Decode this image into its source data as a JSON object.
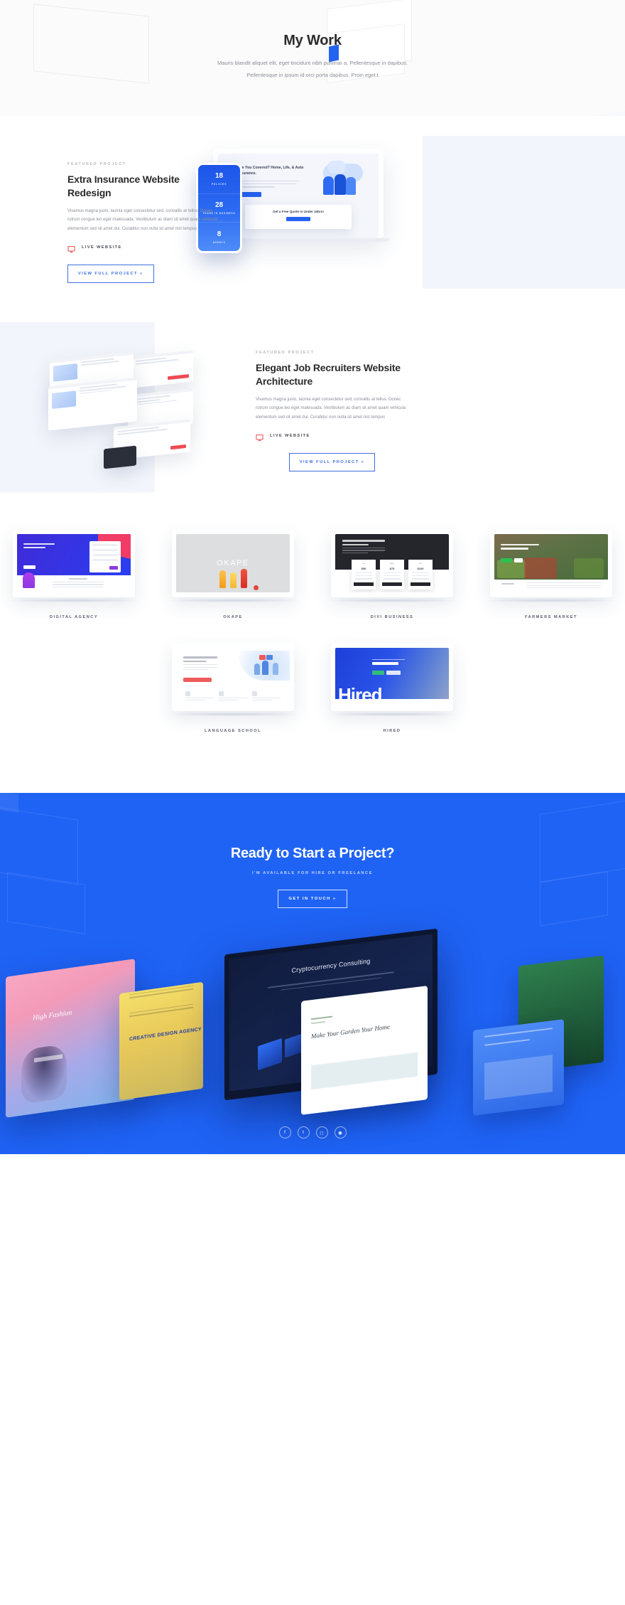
{
  "hero": {
    "title": "My Work",
    "paragraph_line1": "Mauris blandit aliquet elit, eget tincidunt nibh pulvinar a. Pellentesque in dapibus.",
    "paragraph_line2": "Pellentesque in ipsum id orci porta dapibus. Proin eget t"
  },
  "projects": [
    {
      "eyebrow": "FEATURED PROJECT",
      "title": "Extra Insurance Website Redesign",
      "body": "Vivamus magna justo, lacinia eget consectetur sed, convallis at tellus. Donec rutrum congue leo eget malesuada. Vestibulum ac diam sit amet quam vehicula elementum sed sit amet dui. Curabitur non nulla sit amet nisl tempus",
      "live_label": "LIVE WEBSITE",
      "button_label": "VIEW FULL PROJECT »",
      "mockup": {
        "headline": "Are You Covered? Home, Life, & Auto Insurance.",
        "quote_title": "Get a Free Quote in Under 24hrs!",
        "stats": [
          {
            "number": "18",
            "label": "POLICIES"
          },
          {
            "number": "28",
            "label": "YEARS IN BUSINESS"
          },
          {
            "number": "8",
            "label": "AGENTS"
          }
        ]
      }
    },
    {
      "eyebrow": "FEATURED PROJECT",
      "title": "Elegant Job Recruiters Website Architecture",
      "body": "Vivamus magna justo, lacinia eget consectetur sed, convallis at tellus. Donec rutrum congue leo eget malesuada. Vestibulum ac diam sit amet quam vehicula elementum sed sit amet dui. Curabitur non nulla sit amet nisl tempus",
      "live_label": "LIVE WEBSITE",
      "button_label": "VIEW FULL PROJECT »"
    }
  ],
  "portfolio": {
    "items": [
      {
        "caption": "DIGITAL AGENCY"
      },
      {
        "caption": "OKAPE"
      },
      {
        "caption": "DIVI BUSINESS"
      },
      {
        "caption": "FARMERS MARKET"
      },
      {
        "caption": "LANGUAGE SCHOOL"
      },
      {
        "caption": "HIRED"
      }
    ],
    "okape_word": "OKAPE",
    "hired_word": "Hired"
  },
  "cta": {
    "title": "Ready to Start a Project?",
    "subtitle": "I'M AVAILABLE FOR HIRE OR FREELANCE",
    "button_label": "GET IN TOUCH »",
    "collage": {
      "fashion_title": "High Fashion",
      "creative_title": "CREATIVE DESIGN AGENCY",
      "monitor_title": "Cryptocurrency Consulting",
      "garden_title": "Make Your Garden Your Home"
    },
    "socials": [
      {
        "name": "facebook-icon",
        "glyph": "f"
      },
      {
        "name": "twitter-icon",
        "glyph": "t"
      },
      {
        "name": "instagram-icon",
        "glyph": "◻"
      },
      {
        "name": "dribbble-icon",
        "glyph": "◉"
      }
    ]
  },
  "colors": {
    "brand_blue": "#1f63f5",
    "accent_red": "#ee5b5b",
    "hero_bg": "#f7f8f9",
    "panel_bg": "#f2f5fb"
  }
}
